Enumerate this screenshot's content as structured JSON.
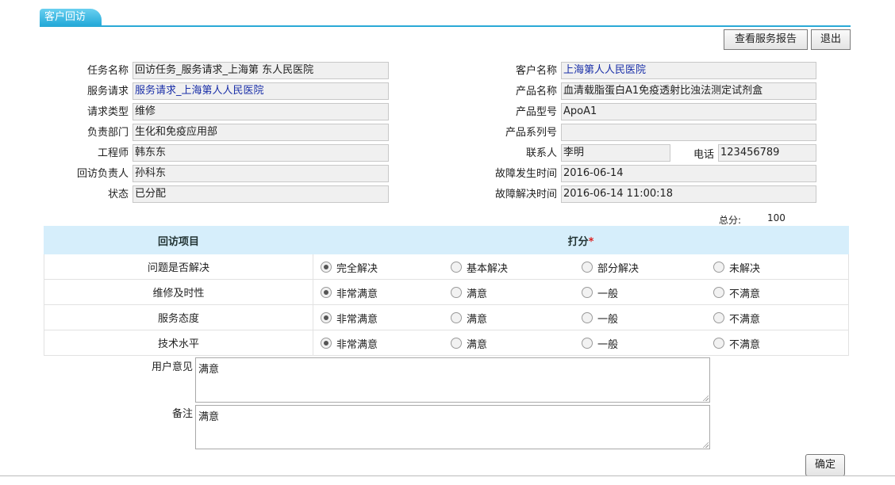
{
  "tab": {
    "label": "客户回访"
  },
  "toolbar": {
    "view_report": "查看服务报告",
    "exit": "退出"
  },
  "left_fields": [
    {
      "label": "任务名称",
      "value": "回访任务_服务请求_上海第 东人民医院",
      "link": false
    },
    {
      "label": "服务请求",
      "value": "服务请求_上海第人人民医院",
      "link": true
    },
    {
      "label": "请求类型",
      "value": "维修",
      "link": false
    },
    {
      "label": "负责部门",
      "value": "生化和免疫应用部",
      "link": false
    },
    {
      "label": "工程师",
      "value": "韩东东",
      "link": false
    },
    {
      "label": "回访负责人",
      "value": "孙科东",
      "link": false
    },
    {
      "label": "状态",
      "value": "已分配",
      "link": false
    }
  ],
  "right_fields": {
    "customer": {
      "label": "客户名称",
      "value": "上海第人人民医院"
    },
    "product_name": {
      "label": "产品名称",
      "value": "血清载脂蛋白A1免疫透射比浊法测定试剂盒"
    },
    "product_model": {
      "label": "产品型号",
      "value": "ApoA1"
    },
    "serial": {
      "label": "产品系列号",
      "value": ""
    },
    "contact": {
      "label": "联系人",
      "value": "李明"
    },
    "phone": {
      "label": "电话",
      "value": "123456789"
    },
    "fault_time": {
      "label": "故障发生时间",
      "value": "2016-06-14"
    },
    "resolve_time": {
      "label": "故障解决时间",
      "value": "2016-06-14 11:00:18"
    }
  },
  "score": {
    "label": "总分:",
    "value": "100"
  },
  "rating_table": {
    "header_item": "回访项目",
    "header_score": "打分",
    "required_mark": "*",
    "rows": [
      {
        "item": "问题是否解决",
        "options": [
          "完全解决",
          "基本解决",
          "部分解决",
          "未解决"
        ],
        "selected": 0
      },
      {
        "item": "维修及时性",
        "options": [
          "非常满意",
          "满意",
          "一般",
          "不满意"
        ],
        "selected": 0
      },
      {
        "item": "服务态度",
        "options": [
          "非常满意",
          "满意",
          "一般",
          "不满意"
        ],
        "selected": 0
      },
      {
        "item": "技术水平",
        "options": [
          "非常满意",
          "满意",
          "一般",
          "不满意"
        ],
        "selected": 0
      }
    ]
  },
  "feedback": {
    "label": "用户意见",
    "value": "满意"
  },
  "remark": {
    "label": "备注",
    "value": "满意"
  },
  "confirm": "确定"
}
